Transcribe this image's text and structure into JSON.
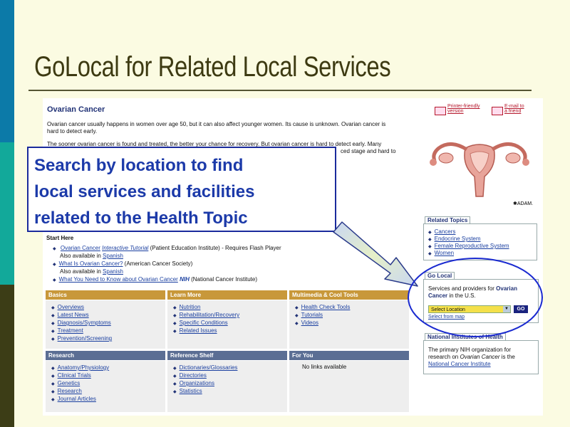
{
  "slide": {
    "title": "GoLocal for Related Local Services",
    "callout": [
      "Search by location to find",
      "local services and facilities",
      "related to the Health Topic"
    ]
  },
  "page": {
    "heading": "Ovarian Cancer",
    "intro1_a": "Ovarian cancer usually happens in women over age 50, but it can also affect younger women. Its cause is unknown. Ovarian cancer is",
    "intro1_b": "hard to detect early.",
    "intro2_a": "The sooner ovarian cancer is found and treated, the better your chance for recovery. But ovarian cancer is hard to detect early. Many",
    "intro2_b": "ced stage and hard to",
    "printer_link": [
      "Printer-friendly",
      "version"
    ],
    "email_link": [
      "E-mail to",
      "a friend"
    ],
    "adam_credit": "✱ADAM.",
    "start_here": "Start Here",
    "start_items": [
      {
        "link": "Ovarian Cancer",
        "link_em": "Interactive Tutorial",
        "text": " (Patient Education Institute) - Requires Flash Player"
      },
      {
        "text": "Also available in ",
        "link": "Spanish",
        "sub": true
      },
      {
        "link": "What Is Ovarian Cancer?",
        "text": " (American Cancer Society)"
      },
      {
        "text": "Also available in ",
        "link": "Spanish",
        "sub": true
      },
      {
        "link": "What You Need to Know about Ovarian Cancer",
        "nih": "NIH",
        "text": " (National Cancer Institute)"
      }
    ],
    "sections": [
      {
        "title": "Basics",
        "items": [
          "Overviews",
          "Latest News",
          "Diagnosis/Symptoms",
          "Treatment",
          "Prevention/Screening"
        ]
      },
      {
        "title": "Learn More",
        "items": [
          "Nutrition",
          "Rehabilitation/Recovery",
          "Specific Conditions",
          "Related Issues"
        ]
      },
      {
        "title": "Multimedia & Cool Tools",
        "items": [
          "Health Check Tools",
          "Tutorials",
          "Videos"
        ]
      },
      {
        "title": "Research",
        "items": [
          "Anatomy/Physiology",
          "Clinical Trials",
          "Genetics",
          "Research",
          "Journal Articles"
        ]
      },
      {
        "title": "Reference Shelf",
        "items": [
          "Dictionaries/Glossaries",
          "Directories",
          "Organizations",
          "Statistics"
        ]
      },
      {
        "title": "For You",
        "text": "No links available"
      }
    ],
    "related_topics": {
      "title": "Related Topics",
      "items": [
        "Cancers",
        "Endocrine System",
        "Female Reproductive System",
        "Women"
      ]
    },
    "go_local": {
      "title": "Go Local",
      "desc1": "Services and providers for",
      "topic1": "Ovarian",
      "topic2": "Cancer",
      "desc2": " in the U.S.",
      "select_value": "Select Location",
      "go_label": "GO",
      "map_link": "Select from map"
    },
    "nih_box": {
      "title": "National Institutes of Health",
      "line1": "The primary NIH organization for",
      "line2a": "research on ",
      "line2b": "Ovarian Cancer",
      "line2c": " is the",
      "link": "National Cancer Institute"
    }
  }
}
